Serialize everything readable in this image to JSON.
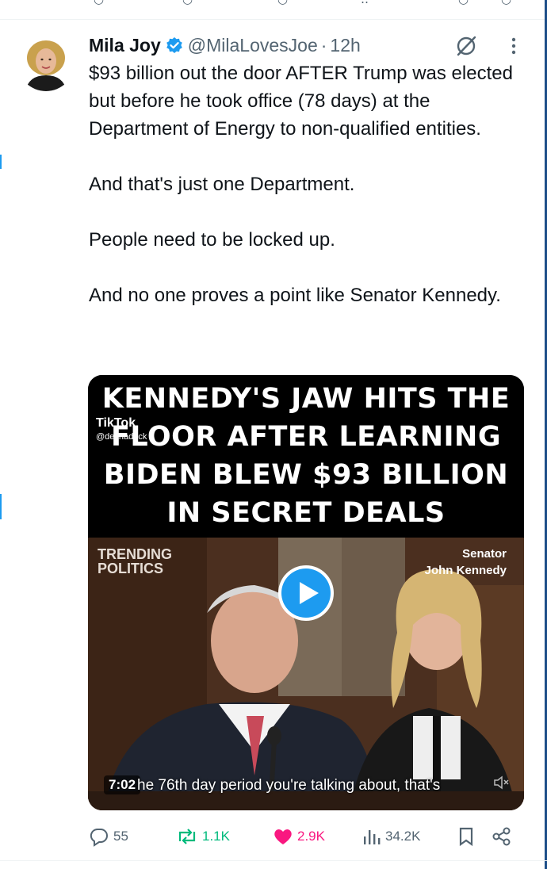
{
  "tweet": {
    "author_name": "Mila Joy",
    "handle": "@MilaLovesJoe",
    "separator": "·",
    "time": "12h",
    "verified_icon": "verified-badge-icon",
    "paragraphs": [
      "$93 billion out the door AFTER Trump was elected but before he took office (78 days) at the Department of Energy to non-qualified entities.",
      "And that's just one Department.",
      "People need to be locked up.",
      "And no one proves a point like Senator Kennedy."
    ]
  },
  "media": {
    "title_lines": [
      "KENNEDY'S JAW HITS THE",
      "FLOOR AFTER LEARNING",
      "BIDEN BLEW $93 BILLION",
      "IN SECRET DEALS"
    ],
    "tiktok_label": "TikTok",
    "tiktok_handle": "@deshadeck",
    "brand_line1": "TRENDING",
    "brand_line2": "POLITICS",
    "senator_line1": "Senator",
    "senator_line2": "John Kennedy",
    "duration": "7:02",
    "caption": "he 76th day period you're talking about, that's"
  },
  "actions": {
    "replies": "55",
    "reposts": "1.1K",
    "likes": "2.9K",
    "views": "34.2K"
  },
  "colors": {
    "accent": "#1d9bf0",
    "like": "#f91880",
    "repost": "#00ba7c",
    "muted": "#536471"
  }
}
